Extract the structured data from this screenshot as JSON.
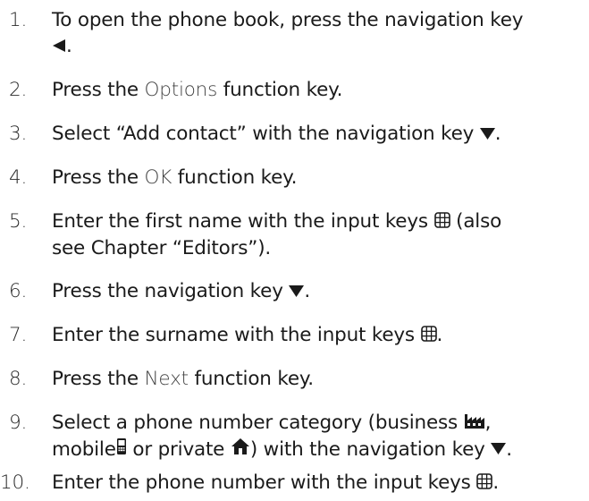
{
  "steps": [
    {
      "num": "1.",
      "line1": "To open the phone book, press the navigation key",
      "line2_after": "."
    },
    {
      "num": "2.",
      "pre": "Press the ",
      "key": "Options",
      "post": " function key."
    },
    {
      "num": "3.",
      "pre": "Select “Add contact” with the navigation key ",
      "post": "."
    },
    {
      "num": "4.",
      "pre": "Press the ",
      "key": "OK",
      "post": " function key."
    },
    {
      "num": "5.",
      "line1_pre": "Enter the first name with the input keys ",
      "line1_post": " (also",
      "line2": "see Chapter “Editors”)."
    },
    {
      "num": "6.",
      "pre": "Press the navigation key ",
      "post": "."
    },
    {
      "num": "7.",
      "pre": "Enter the surname with the input keys ",
      "post": "."
    },
    {
      "num": "8.",
      "pre": "Press the ",
      "key": "Next",
      "post": " function key."
    },
    {
      "num": "9.",
      "line1_pre": "Select a phone number category (business ",
      "line1_post": ",",
      "line2_a": "mobile",
      "line2_b": " or private ",
      "line2_c": ") with the navigation key ",
      "line2_d": "."
    },
    {
      "num": "10.",
      "pre": "Enter the phone number with the input keys ",
      "post": "."
    }
  ],
  "icons": {
    "nav_left": "triangle-left-icon",
    "nav_down": "triangle-down-icon",
    "input_keys": "keypad-icon",
    "business": "factory-icon",
    "mobile": "mobile-phone-icon",
    "private": "house-icon"
  },
  "colors": {
    "text": "#1a1a1a",
    "function_key": "#444444"
  }
}
